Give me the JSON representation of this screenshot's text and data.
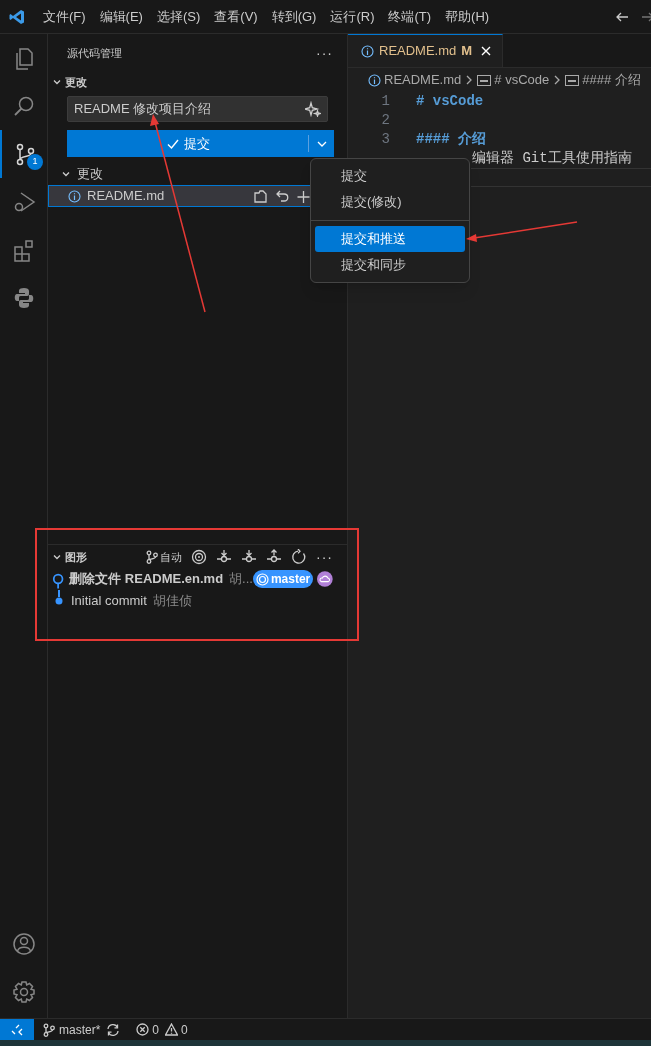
{
  "menu_bar": {
    "items": [
      "文件(F)",
      "编辑(E)",
      "选择(S)",
      "查看(V)",
      "转到(G)",
      "运行(R)",
      "终端(T)",
      "帮助(H)"
    ]
  },
  "activity_bar": {
    "items": [
      {
        "kind": "files",
        "selected": false
      },
      {
        "kind": "search",
        "selected": false
      },
      {
        "kind": "scm",
        "selected": true,
        "badge": "1"
      },
      {
        "kind": "debug",
        "selected": false
      },
      {
        "kind": "extensions",
        "selected": false
      },
      {
        "kind": "python",
        "selected": false
      }
    ],
    "bottom": [
      {
        "kind": "account"
      },
      {
        "kind": "settings"
      }
    ]
  },
  "sidebar": {
    "title": "源代码管理",
    "more_icon": "···",
    "changes_section": {
      "title": "更改",
      "expanded": true,
      "message": "README 修改项目介绍",
      "commit_button": "提交",
      "group": {
        "title": "更改",
        "expanded": true,
        "files": [
          {
            "name": "README.md",
            "selected": true
          }
        ]
      }
    },
    "graph_section": {
      "title": "图形",
      "expanded": true,
      "auto_label": "自动",
      "more_icon": "···",
      "commits": [
        {
          "message": "删除文件 README.en.md",
          "author": "胡...",
          "bold": true,
          "branch": "master",
          "cloud": true
        },
        {
          "message": "Initial commit",
          "author": "胡佳侦",
          "bold": false
        }
      ]
    }
  },
  "commit_menu": {
    "items": [
      {
        "label": "提交",
        "selected": false
      },
      {
        "label": "提交(修改)",
        "selected": false
      },
      {
        "kind": "separator"
      },
      {
        "label": "提交和推送",
        "selected": true
      },
      {
        "label": "提交和同步",
        "selected": false
      }
    ]
  },
  "editor": {
    "tabs": [
      {
        "label": "README.md",
        "status": "M",
        "selected": true
      }
    ],
    "breadcrumbs": [
      "README.md",
      "# vsCode",
      "#### 介绍"
    ],
    "lines": [
      {
        "number": "1",
        "text": "# vsCode",
        "kind": "heading"
      },
      {
        "number": "2",
        "kind": "plain"
      },
      {
        "number": "3",
        "text": "#### 介绍",
        "kind": "heading"
      },
      {
        "text": "编辑器 Git工具使用指南",
        "kind": "plain",
        "covered": true
      }
    ]
  },
  "status_bar": {
    "branch": "master*",
    "errors": "0",
    "warnings": "0"
  }
}
